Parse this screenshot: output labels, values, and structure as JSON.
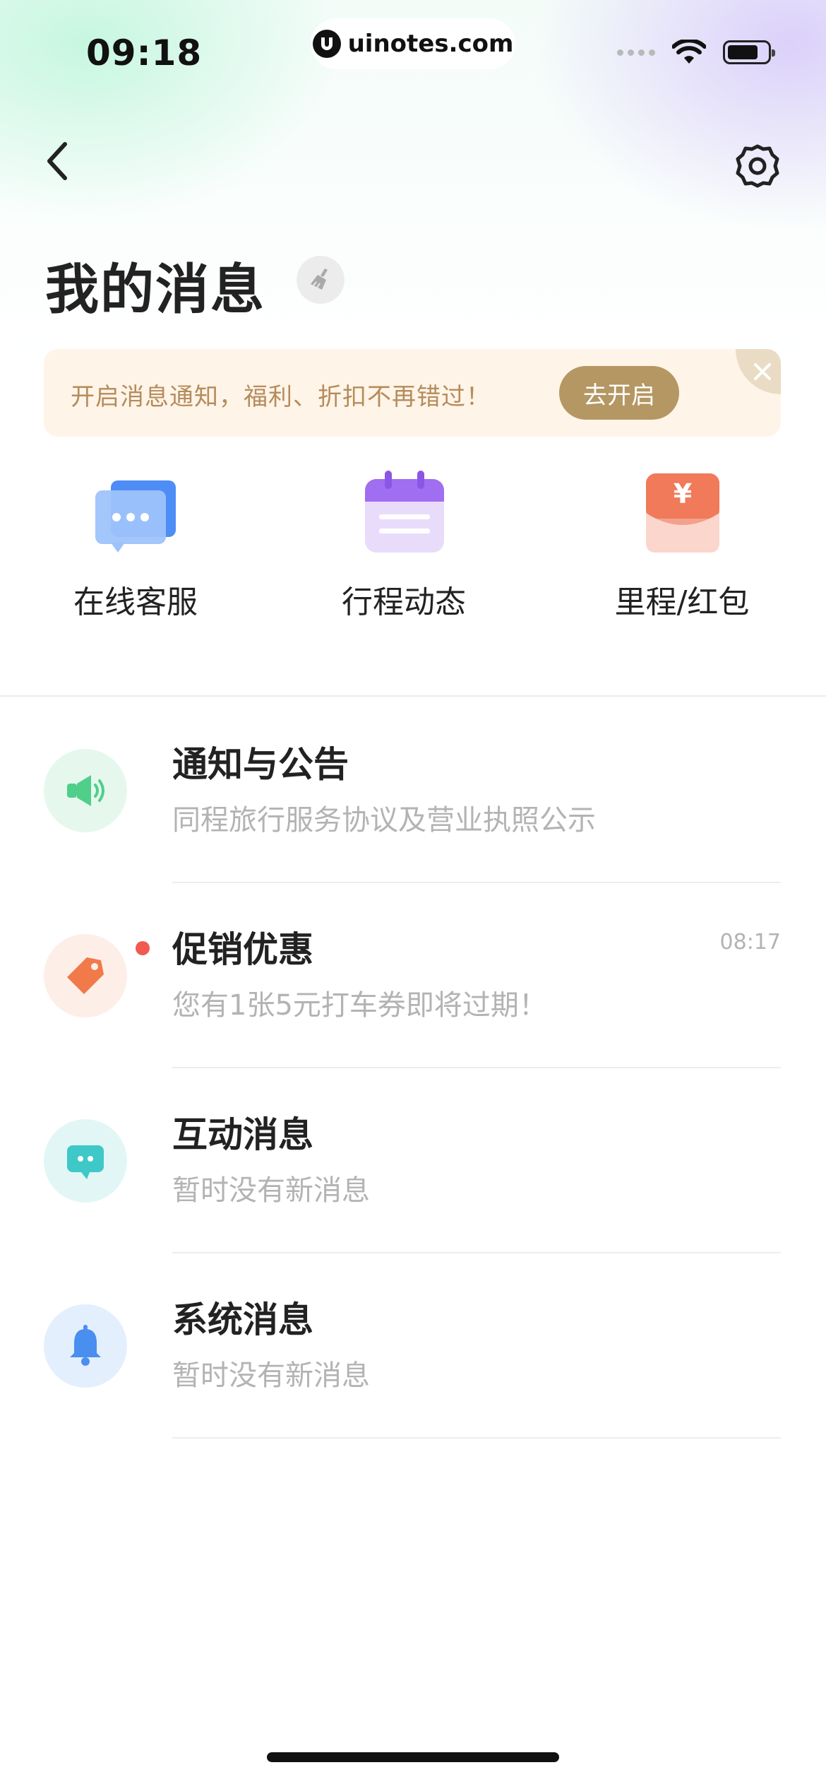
{
  "status_bar": {
    "time": "09:18",
    "url": "uinotes.com"
  },
  "header": {
    "title": "我的消息"
  },
  "banner": {
    "text": "开启消息通知，福利、折扣不再错过！",
    "button": "去开启"
  },
  "shortcuts": [
    {
      "label": "在线客服",
      "icon": "chat-bubbles-icon"
    },
    {
      "label": "行程动态",
      "icon": "calendar-icon"
    },
    {
      "label": "里程/红包",
      "icon": "red-envelope-icon"
    }
  ],
  "messages": [
    {
      "title": "通知与公告",
      "subtitle": "同程旅行服务协议及营业执照公示",
      "time": "",
      "icon": "megaphone-icon",
      "color": "#4fcf8a",
      "bg": "#e8f8ef",
      "unread": false
    },
    {
      "title": "促销优惠",
      "subtitle": "您有1张5元打车券即将过期！",
      "time": "08:17",
      "icon": "tag-icon",
      "color": "#f07a4a",
      "bg": "#fdeee8",
      "unread": true
    },
    {
      "title": "互动消息",
      "subtitle": "暂时没有新消息",
      "time": "",
      "icon": "comment-icon",
      "color": "#3ec8c8",
      "bg": "#e4f7f6",
      "unread": false
    },
    {
      "title": "系统消息",
      "subtitle": "暂时没有新消息",
      "time": "",
      "icon": "bell-icon",
      "color": "#4a8ef0",
      "bg": "#e6f0fd",
      "unread": false
    }
  ]
}
